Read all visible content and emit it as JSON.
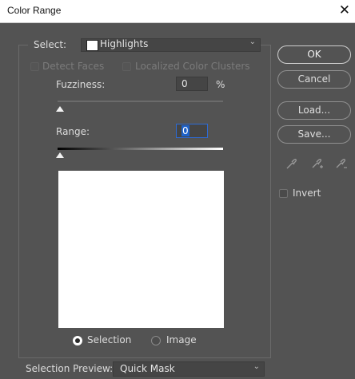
{
  "window": {
    "title": "Color Range",
    "close_glyph": "✕"
  },
  "select": {
    "label": "Select:",
    "value": "Highlights"
  },
  "options": {
    "detect_faces": "Detect Faces",
    "localized_clusters": "Localized Color Clusters"
  },
  "fuzziness": {
    "label": "Fuzziness:",
    "value": "0",
    "unit": "%"
  },
  "range": {
    "label": "Range:",
    "value": "0"
  },
  "view": {
    "selection_label": "Selection",
    "image_label": "Image",
    "selected": "selection"
  },
  "preview": {
    "label": "Selection Preview:",
    "value": "Quick Mask"
  },
  "buttons": {
    "ok": "OK",
    "cancel": "Cancel",
    "load": "Load...",
    "save": "Save..."
  },
  "invert": {
    "label": "Invert",
    "checked": false
  },
  "icons": [
    "eyedropper-icon",
    "eyedropper-plus-icon",
    "eyedropper-minus-icon"
  ]
}
